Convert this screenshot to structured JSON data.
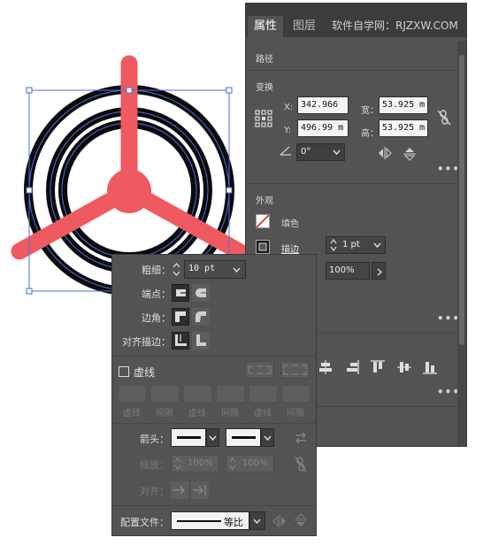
{
  "canvas": {
    "colors": {
      "ring": "#0b0b0b",
      "blade": "#ee5a5f",
      "selection": "#4c6ddf"
    }
  },
  "properties_panel": {
    "tabs": [
      {
        "label": "属性"
      },
      {
        "label": "图层"
      }
    ],
    "watermark": "软件自学网：RJZXW.COM",
    "path_label": "路径",
    "transform": {
      "title": "变换",
      "x_label": "X:",
      "x_value": "342.966",
      "y_label": "Y:",
      "y_value": "496.99 m",
      "w_label": "宽：",
      "w_value": "53.925 m",
      "h_label": "高：",
      "h_value": "53.925 m",
      "angle_value": "0°"
    },
    "appearance": {
      "title": "外观",
      "fill_label": "填色",
      "stroke_label": "描边",
      "stroke_weight": "1 pt",
      "opacity_value": "100%"
    }
  },
  "stroke_panel": {
    "weight_label": "粗细：",
    "weight_value": "10 pt",
    "cap_label": "端点：",
    "corner_label": "边角：",
    "align_label": "对齐描边：",
    "dashed_label": "虚线",
    "dash_labels": [
      "虚线",
      "间隙",
      "虚线",
      "间隙",
      "虚线",
      "间隙"
    ],
    "arrow_label": "箭头：",
    "scale_label": "缩放：",
    "scale_start": "100%",
    "scale_end": "100%",
    "align_arrow_label": "对齐：",
    "profile_label": "配置文件：",
    "profile_value": "等比"
  }
}
